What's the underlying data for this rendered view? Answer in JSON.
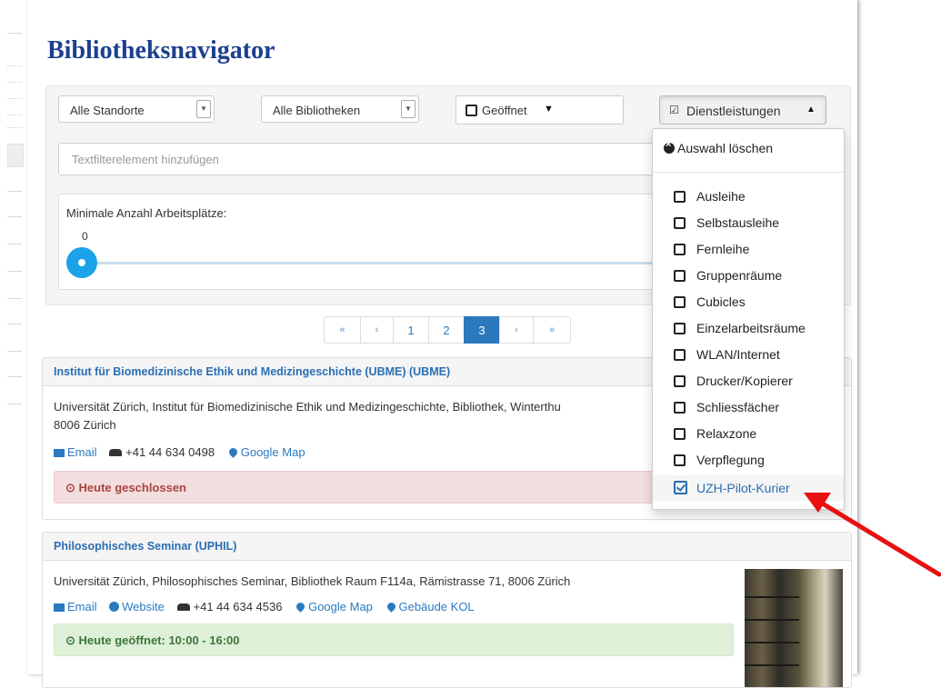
{
  "app": {
    "title": "Bibliotheksnavigator"
  },
  "filters": {
    "standort": "Alle Standorte",
    "bibliothek": "Alle Bibliotheken",
    "geoeffnet": "Geöffnet",
    "dienstleistungen": "Dienstleistungen",
    "textfilter_placeholder": "Textfilterelement hinzufügen",
    "slider_label": "Minimale Anzahl Arbeitsplätze:",
    "slider_value": "0"
  },
  "pagination": {
    "items": [
      "«",
      "‹",
      "1",
      "2",
      "3",
      "›",
      "»"
    ],
    "active": "3"
  },
  "dropdown": {
    "clear_label": "Auswahl löschen",
    "items": [
      {
        "label": "Ausleihe",
        "checked": false
      },
      {
        "label": "Selbstausleihe",
        "checked": false
      },
      {
        "label": "Fernleihe",
        "checked": false
      },
      {
        "label": "Gruppenräume",
        "checked": false
      },
      {
        "label": "Cubicles",
        "checked": false
      },
      {
        "label": "Einzelarbeitsräume",
        "checked": false
      },
      {
        "label": "WLAN/Internet",
        "checked": false
      },
      {
        "label": "Drucker/Kopierer",
        "checked": false
      },
      {
        "label": "Schliessfächer",
        "checked": false
      },
      {
        "label": "Relaxzone",
        "checked": false
      },
      {
        "label": "Verpflegung",
        "checked": false
      },
      {
        "label": "UZH-Pilot-Kurier",
        "checked": true
      }
    ]
  },
  "libraries": [
    {
      "name": "Institut für Biomedizinische Ethik und Medizingeschichte (UBME) (UBME)",
      "address_line1": "Universität Zürich, Institut für Biomedizinische Ethik und Medizingeschichte, Bibliothek, Winterthu",
      "address_line2": "8006 Zürich",
      "email": "Email",
      "phone": "+41 44 634 0498",
      "map": "Google Map",
      "status": "Heute geschlossen"
    },
    {
      "name": "Philosophisches Seminar (UPHIL)",
      "address_line1": "Universität Zürich, Philosophisches Seminar, Bibliothek Raum F114a, Rämistrasse 71, 8006 Zürich",
      "email": "Email",
      "website": "Website",
      "phone": "+41 44 634 4536",
      "map": "Google Map",
      "building": "Gebäude KOL",
      "status": "Heute geöffnet: 10:00 - 16:00"
    }
  ],
  "colors": {
    "title": "#1c3f8e",
    "link": "#2a7ac2",
    "slider_handle": "#1aa3ea",
    "pagination_active": "#2c78bd",
    "arrow": "#e81010"
  },
  "icons": {
    "clear": "times-circle-icon",
    "checkbox": "square-o-icon",
    "checked": "check-square-icon",
    "email": "envelope-icon",
    "phone": "phone-icon",
    "map": "map-marker-icon",
    "website": "globe-icon",
    "clock": "clock-icon"
  }
}
